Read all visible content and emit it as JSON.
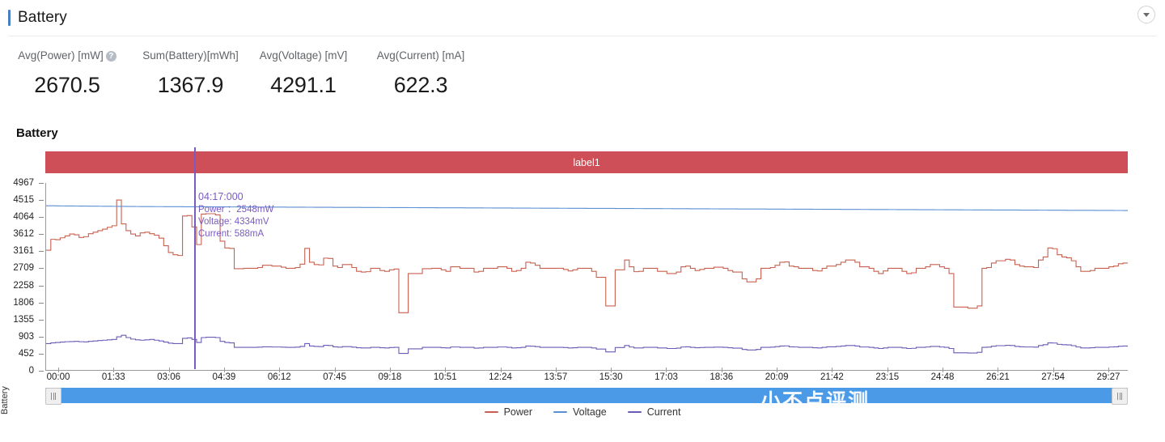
{
  "header": {
    "title": "Battery",
    "collapse_icon": "chevron-down-icon"
  },
  "stats": [
    {
      "label": "Avg(Power) [mW]",
      "value": "2670.5",
      "help_icon": "help-icon",
      "has_help": true
    },
    {
      "label": "Sum(Battery)[mWh]",
      "value": "1367.9",
      "has_help": false
    },
    {
      "label": "Avg(Voltage) [mV]",
      "value": "4291.1",
      "has_help": false
    },
    {
      "label": "Avg(Current) [mA]",
      "value": "622.3",
      "has_help": false
    }
  ],
  "chart_heading": "Battery",
  "label_bar": {
    "text": "label1",
    "color": "#cf4f58"
  },
  "tooltip": {
    "time": "04:17:000",
    "power": "Power ：2548mW",
    "voltage": "Voltage: 4334mV",
    "current": "Current: 588mA",
    "color": "#7a5bc2"
  },
  "scrollbar": {
    "track_color": "#4a9ae8",
    "left_handle_icon": "grip-handle-icon",
    "right_handle_icon": "grip-handle-icon",
    "watermark_text": "小不点评测"
  },
  "legend": {
    "position": "bottom-center",
    "items": [
      {
        "label": "Power",
        "color": "#c8604f"
      },
      {
        "label": "Voltage",
        "color": "#5b8fd4"
      },
      {
        "label": "Current",
        "color": "#6a5bb5"
      }
    ]
  },
  "chart_data": {
    "type": "line",
    "title": "Battery",
    "xlabel": "",
    "ylabel": "Battery",
    "grid": false,
    "legend_position": "bottom-center",
    "ylim": [
      0,
      4967
    ],
    "yticks": [
      0,
      452,
      903,
      1355,
      1806,
      2258,
      2709,
      3161,
      3612,
      4064,
      4515,
      4967
    ],
    "xticks": [
      "00:00",
      "01:33",
      "03:06",
      "04:39",
      "06:12",
      "07:45",
      "09:18",
      "10:51",
      "12:24",
      "13:57",
      "15:30",
      "17:03",
      "18:36",
      "20:09",
      "21:42",
      "23:15",
      "24:48",
      "26:21",
      "27:54",
      "29:27"
    ],
    "x_range_minutes": [
      0,
      30.5
    ],
    "series": [
      {
        "name": "Power",
        "unit": "mW",
        "color": "#c8604f",
        "style": "step",
        "values": [
          3180,
          3470,
          3460,
          3510,
          3560,
          3610,
          3590,
          3520,
          3540,
          3620,
          3660,
          3700,
          3740,
          3790,
          3830,
          4515,
          3880,
          3700,
          3610,
          3560,
          3640,
          3660,
          3620,
          3580,
          3500,
          3300,
          3120,
          3060,
          3040,
          4090,
          4100,
          3800,
          3330,
          4140,
          4150,
          4150,
          4120,
          3420,
          3240,
          3230,
          2690,
          2690,
          2700,
          2700,
          2700,
          2720,
          2780,
          2780,
          2760,
          2760,
          2730,
          2700,
          2700,
          2720,
          2810,
          3230,
          2860,
          2800,
          2790,
          2970,
          2960,
          2760,
          2720,
          2800,
          2800,
          2720,
          2620,
          2600,
          2610,
          2700,
          2700,
          2640,
          2620,
          2660,
          2680,
          1520,
          1520,
          2560,
          2560,
          2560,
          2690,
          2690,
          2700,
          2700,
          2660,
          2620,
          2740,
          2740,
          2700,
          2700,
          2700,
          2600,
          2620,
          2700,
          2700,
          2700,
          2740,
          2740,
          2700,
          2620,
          2640,
          2700,
          2860,
          2840,
          2780,
          2700,
          2700,
          2700,
          2700,
          2700,
          2670,
          2630,
          2660,
          2700,
          2700,
          2700,
          2620,
          2460,
          2460,
          1700,
          1700,
          2660,
          2660,
          2920,
          2740,
          2610,
          2620,
          2700,
          2700,
          2700,
          2620,
          2620,
          2560,
          2560,
          2600,
          2740,
          2760,
          2700,
          2640,
          2670,
          2700,
          2700,
          2730,
          2730,
          2700,
          2640,
          2600,
          2600,
          2420,
          2340,
          2340,
          2420,
          2700,
          2700,
          2720,
          2780,
          2860,
          2870,
          2760,
          2740,
          2700,
          2700,
          2700,
          2640,
          2630,
          2700,
          2760,
          2760,
          2800,
          2860,
          2920,
          2920,
          2860,
          2740,
          2740,
          2700,
          2620,
          2560,
          2630,
          2700,
          2700,
          2700,
          2620,
          2560,
          2580,
          2700,
          2700,
          2740,
          2800,
          2800,
          2740,
          2700,
          2560,
          1670,
          1670,
          1670,
          1640,
          1640,
          1700,
          2700,
          2720,
          2840,
          2900,
          2900,
          2940,
          2920,
          2800,
          2760,
          2740,
          2740,
          2720,
          2920,
          3000,
          3240,
          3220,
          3060,
          3000,
          2980,
          2900,
          2740,
          2620,
          2620,
          2640,
          2700,
          2700,
          2700,
          2740,
          2760,
          2820,
          2840
        ]
      },
      {
        "name": "Voltage",
        "unit": "mV",
        "color": "#5b8fd4",
        "style": "step",
        "values": [
          4360,
          4360,
          4358,
          4357,
          4356,
          4355,
          4354,
          4353,
          4352,
          4351,
          4350,
          4349,
          4348,
          4347,
          4346,
          4345,
          4344,
          4343,
          4342,
          4341,
          4340,
          4340,
          4339,
          4338,
          4338,
          4337,
          4337,
          4336,
          4336,
          4335,
          4335,
          4334,
          4334,
          4333,
          4333,
          4332,
          4332,
          4331,
          4331,
          4330,
          4330,
          4329,
          4329,
          4328,
          4328,
          4327,
          4327,
          4326,
          4326,
          4325,
          4325,
          4324,
          4324,
          4323,
          4323,
          4322,
          4322,
          4321,
          4321,
          4320,
          4320,
          4319,
          4319,
          4318,
          4318,
          4317,
          4317,
          4316,
          4316,
          4315,
          4315,
          4314,
          4314,
          4313,
          4313,
          4312,
          4312,
          4311,
          4311,
          4310,
          4310,
          4309,
          4309,
          4308,
          4308,
          4307,
          4307,
          4306,
          4306,
          4305,
          4305,
          4304,
          4304,
          4303,
          4303,
          4302,
          4302,
          4301,
          4301,
          4300,
          4300,
          4299,
          4299,
          4298,
          4298,
          4297,
          4297,
          4296,
          4296,
          4295,
          4295,
          4294,
          4294,
          4293,
          4293,
          4292,
          4292,
          4291,
          4291,
          4290,
          4290,
          4289,
          4289,
          4288,
          4288,
          4287,
          4287,
          4286,
          4286,
          4285,
          4285,
          4284,
          4284,
          4283,
          4283,
          4282,
          4282,
          4281,
          4281,
          4280,
          4280,
          4279,
          4279,
          4278,
          4278,
          4277,
          4277,
          4276,
          4276,
          4275,
          4275,
          4274,
          4274,
          4273,
          4273,
          4272,
          4272,
          4271,
          4271,
          4270,
          4270,
          4269,
          4269,
          4268,
          4268,
          4267,
          4267,
          4266,
          4266,
          4265,
          4265,
          4264,
          4264,
          4263,
          4263,
          4262,
          4262,
          4261,
          4261,
          4260,
          4260,
          4259,
          4259,
          4258,
          4258,
          4257,
          4257,
          4256,
          4256,
          4255,
          4255,
          4254,
          4254,
          4253,
          4253,
          4252,
          4252,
          4251,
          4251,
          4250,
          4250,
          4249,
          4249,
          4248,
          4248,
          4247,
          4247,
          4246,
          4246,
          4245,
          4245,
          4244,
          4244,
          4243,
          4243,
          4242,
          4242,
          4241,
          4241,
          4240,
          4240,
          4239,
          4239,
          4238,
          4238,
          4237,
          4237,
          4236,
          4236,
          4235
        ]
      },
      {
        "name": "Current",
        "unit": "mA",
        "color": "#6a5bb5",
        "style": "step",
        "values": [
          700,
          720,
          730,
          740,
          750,
          755,
          760,
          750,
          745,
          760,
          770,
          780,
          790,
          800,
          810,
          880,
          920,
          860,
          820,
          800,
          790,
          800,
          810,
          790,
          770,
          740,
          710,
          700,
          700,
          840,
          850,
          810,
          730,
          860,
          870,
          870,
          860,
          760,
          730,
          720,
          600,
          600,
          600,
          600,
          600,
          605,
          615,
          615,
          610,
          610,
          605,
          600,
          600,
          605,
          625,
          700,
          635,
          625,
          620,
          655,
          650,
          615,
          605,
          620,
          620,
          605,
          590,
          585,
          585,
          600,
          600,
          590,
          585,
          595,
          600,
          440,
          440,
          560,
          560,
          560,
          600,
          600,
          600,
          600,
          590,
          585,
          610,
          610,
          600,
          600,
          600,
          580,
          585,
          600,
          600,
          600,
          610,
          610,
          600,
          585,
          590,
          600,
          635,
          630,
          620,
          600,
          600,
          600,
          600,
          600,
          595,
          585,
          590,
          600,
          600,
          600,
          585,
          555,
          555,
          480,
          480,
          595,
          595,
          650,
          610,
          585,
          585,
          600,
          600,
          600,
          585,
          585,
          570,
          570,
          580,
          610,
          615,
          600,
          590,
          595,
          600,
          600,
          605,
          605,
          600,
          590,
          580,
          580,
          545,
          530,
          530,
          545,
          600,
          600,
          605,
          620,
          635,
          640,
          615,
          610,
          600,
          600,
          600,
          590,
          585,
          600,
          615,
          615,
          625,
          635,
          650,
          650,
          635,
          610,
          610,
          600,
          585,
          570,
          585,
          600,
          600,
          600,
          585,
          570,
          575,
          600,
          600,
          610,
          625,
          625,
          610,
          600,
          570,
          455,
          455,
          455,
          450,
          450,
          470,
          600,
          605,
          630,
          645,
          645,
          655,
          650,
          625,
          615,
          610,
          610,
          605,
          650,
          670,
          720,
          715,
          680,
          670,
          665,
          645,
          610,
          585,
          585,
          590,
          600,
          600,
          600,
          610,
          615,
          630,
          635
        ]
      }
    ]
  }
}
